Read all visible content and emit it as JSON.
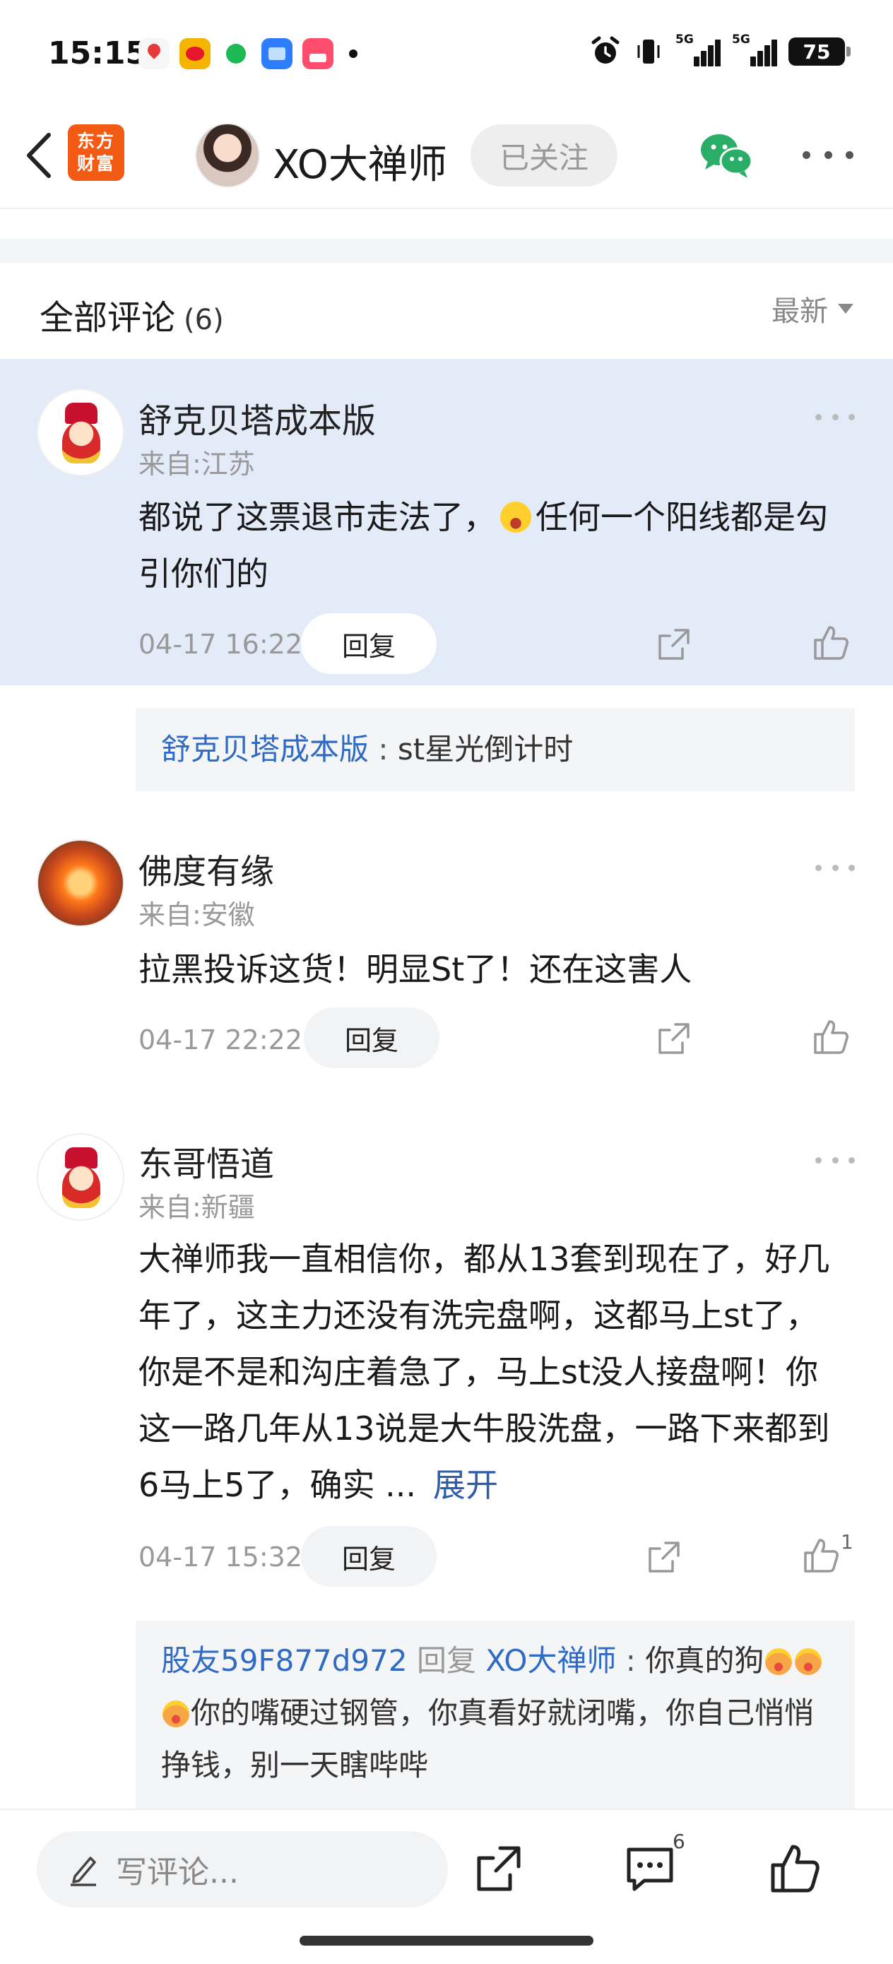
{
  "status_bar": {
    "time": "15:15",
    "notification_apps": [
      "map-app-icon",
      "weibo-app-icon",
      "spotify-app-icon",
      "files-app-icon",
      "travel-app-icon"
    ],
    "signal_labels": [
      "5G",
      "5G"
    ],
    "battery": "75"
  },
  "header": {
    "logo_line1": "东方",
    "logo_line2": "财富",
    "username": "XO大禅师",
    "follow_label": "已关注",
    "colors": {
      "logo_bg": "#f35b14",
      "wechat": "#2aae67"
    }
  },
  "section": {
    "title": "全部评论",
    "count": "(6)",
    "sort_label": "最新"
  },
  "comments": [
    {
      "name": "舒克贝塔成本版",
      "location": "来自:江苏",
      "text_before_emoji": "都说了这票退市走法了，",
      "text_after_emoji": "任何一个阳线都是勾引你们的",
      "time": "04-17 16:22",
      "reply_label": "回复",
      "reply": {
        "user": "舒克贝塔成本版",
        "sep": " : ",
        "text": "st星光倒计时"
      }
    },
    {
      "name": "佛度有缘",
      "location": "来自:安徽",
      "text": "拉黑投诉这货！明显St了！还在这害人",
      "time": "04-17 22:22",
      "reply_label": "回复"
    },
    {
      "name": "东哥悟道",
      "location": "来自:新疆",
      "text": "大禅师我一直相信你，都从13套到现在了，好几年了，这主力还没有洗完盘啊，这都马上st了，你是不是和沟庄着急了，马上st没人接盘啊！你这一路几年从13说是大牛股洗盘，一路下来都到6马上5了，确实 ...",
      "expand_label": "展开",
      "time": "04-17 15:32",
      "reply_label": "回复",
      "like_count": "1",
      "reply": {
        "user": "股友59F877d972",
        "verb": " 回复 ",
        "target": "XO大禅师",
        "sep": " : ",
        "text1": "你真的狗",
        "text2": "你的嘴硬过钢管，你真看好就闭嘴，你自己悄悄挣钱，别一天瞎哔哔"
      }
    }
  ],
  "bottom_bar": {
    "input_placeholder": "写评论...",
    "comment_count": "6"
  }
}
